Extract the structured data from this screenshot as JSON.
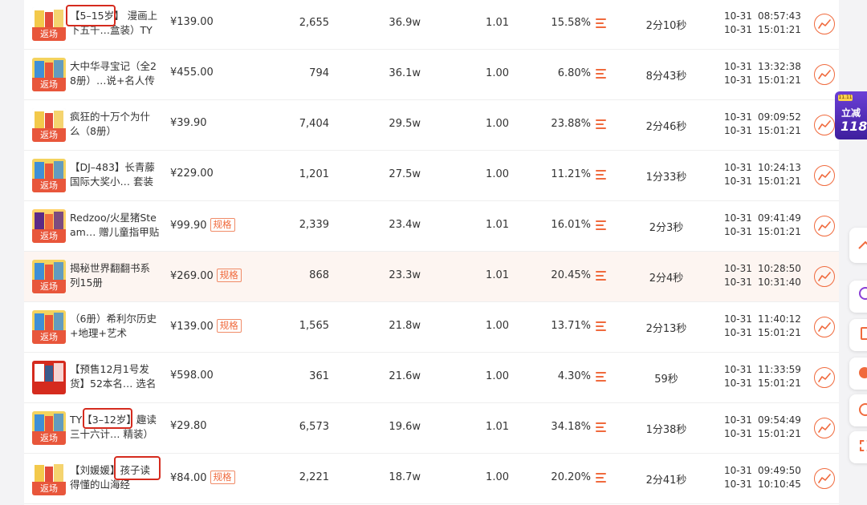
{
  "common": {
    "tag_label": "返场",
    "spec_label": "规格"
  },
  "promo": {
    "badge": "11.11",
    "line1": "立减",
    "line2": "118"
  },
  "colors": {
    "accent": "#f06a3d",
    "tag": "#e8563b",
    "highlight_row": "#fdf5f1",
    "annotation": "#d52b1e"
  },
  "rows": [
    {
      "title": "【5–15岁】 漫画上下五千…盒装）TY",
      "price": "¥139.00",
      "has_spec": false,
      "tag": true,
      "sales": "2,655",
      "views": "36.9w",
      "ratio": "1.01",
      "conversion": "15.58%",
      "duration": "2分10秒",
      "start_date": "10-31",
      "start_time": "08:57:43",
      "end_date": "10-31",
      "end_time": "15:01:21",
      "icon": "book-cover",
      "highlight": false
    },
    {
      "title": "大中华寻宝记（全28册）…说+名人传",
      "price": "¥455.00",
      "has_spec": false,
      "tag": true,
      "sales": "794",
      "views": "36.1w",
      "ratio": "1.00",
      "conversion": "6.80%",
      "duration": "8分43秒",
      "start_date": "10-31",
      "start_time": "13:32:38",
      "end_date": "10-31",
      "end_time": "15:01:21",
      "icon": "book-set",
      "highlight": false
    },
    {
      "title": "疯狂的十万个为什么（8册）",
      "price": "¥39.90",
      "has_spec": false,
      "tag": true,
      "sales": "7,404",
      "views": "29.5w",
      "ratio": "1.00",
      "conversion": "23.88%",
      "duration": "2分46秒",
      "start_date": "10-31",
      "start_time": "09:09:52",
      "end_date": "10-31",
      "end_time": "15:01:21",
      "icon": "book-cover",
      "highlight": false
    },
    {
      "title": "【DJ–483】长青藤国际大奖小… 套装",
      "price": "¥229.00",
      "has_spec": false,
      "tag": true,
      "sales": "1,201",
      "views": "27.5w",
      "ratio": "1.00",
      "conversion": "11.21%",
      "duration": "1分33秒",
      "start_date": "10-31",
      "start_time": "10:24:13",
      "end_date": "10-31",
      "end_time": "15:01:21",
      "icon": "book-set",
      "highlight": false
    },
    {
      "title": "Redzoo/火星猪Steam… 赠儿童指甲贴",
      "price": "¥99.90",
      "has_spec": true,
      "tag": true,
      "sales": "2,339",
      "views": "23.4w",
      "ratio": "1.01",
      "conversion": "16.01%",
      "duration": "2分3秒",
      "start_date": "10-31",
      "start_time": "09:41:49",
      "end_date": "10-31",
      "end_time": "15:01:21",
      "icon": "toy-box",
      "highlight": false
    },
    {
      "title": "揭秘世界翻翻书系列15册",
      "price": "¥269.00",
      "has_spec": true,
      "tag": true,
      "sales": "868",
      "views": "23.3w",
      "ratio": "1.01",
      "conversion": "20.45%",
      "duration": "2分4秒",
      "start_date": "10-31",
      "start_time": "10:28:50",
      "end_date": "10-31",
      "end_time": "10:31:40",
      "icon": "book-set",
      "highlight": true
    },
    {
      "title": "（6册）希利尔历史+地理+艺术",
      "price": "¥139.00",
      "has_spec": true,
      "tag": true,
      "sales": "1,565",
      "views": "21.8w",
      "ratio": "1.00",
      "conversion": "13.71%",
      "duration": "2分13秒",
      "start_date": "10-31",
      "start_time": "11:40:12",
      "end_date": "10-31",
      "end_time": "15:01:21",
      "icon": "book-set",
      "highlight": false
    },
    {
      "title": "【预售12月1号发货】52本名… 选名著",
      "price": "¥598.00",
      "has_spec": false,
      "tag": false,
      "sales": "361",
      "views": "21.6w",
      "ratio": "1.00",
      "conversion": "4.30%",
      "duration": "59秒",
      "start_date": "10-31",
      "start_time": "11:33:59",
      "end_date": "10-31",
      "end_time": "15:01:21",
      "icon": "book-box",
      "highlight": false
    },
    {
      "title": "TY【3–12岁】趣读三十六计… 精装）",
      "price": "¥29.80",
      "has_spec": false,
      "tag": true,
      "sales": "6,573",
      "views": "19.6w",
      "ratio": "1.01",
      "conversion": "34.18%",
      "duration": "1分38秒",
      "start_date": "10-31",
      "start_time": "09:54:49",
      "end_date": "10-31",
      "end_time": "15:01:21",
      "icon": "book-set",
      "highlight": false
    },
    {
      "title": "【刘媛媛】孩子读得懂的山海经",
      "price": "¥84.00",
      "has_spec": true,
      "tag": true,
      "sales": "2,221",
      "views": "18.7w",
      "ratio": "1.00",
      "conversion": "20.20%",
      "duration": "2分41秒",
      "start_date": "10-31",
      "start_time": "09:49:50",
      "end_date": "10-31",
      "end_time": "10:10:45",
      "icon": "book-cover",
      "highlight": false
    }
  ]
}
